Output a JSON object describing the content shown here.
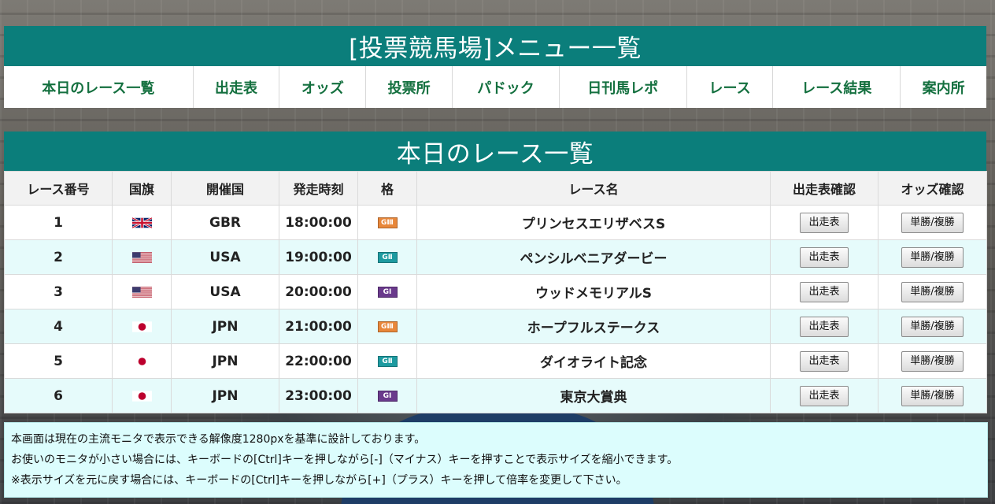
{
  "colors": {
    "header": "#0b7e7b",
    "nav_text": "#14703f",
    "row_alt": "#e6fbfb",
    "notice_bg": "#dcfdfd"
  },
  "menu": {
    "title": "[投票競馬場]メニュー一覧",
    "items": [
      {
        "label": "本日のレース一覧"
      },
      {
        "label": "出走表"
      },
      {
        "label": "オッズ"
      },
      {
        "label": "投票所"
      },
      {
        "label": "パドック"
      },
      {
        "label": "日刊馬レポ"
      },
      {
        "label": "レース"
      },
      {
        "label": "レース結果"
      },
      {
        "label": "案内所"
      }
    ]
  },
  "races": {
    "title": "本日のレース一覧",
    "columns": [
      "レース番号",
      "国旗",
      "開催国",
      "発走時刻",
      "格",
      "レース名",
      "出走表確認",
      "オッズ確認"
    ],
    "rows": [
      {
        "no": "1",
        "flag": "uk-flag-icon",
        "country": "GBR",
        "time": "18:00:00",
        "grade": "GⅢ",
        "grade_color": "#e8873a",
        "name": "プリンセスエリザベスS",
        "entry_btn": "出走表",
        "odds_btn": "単勝/複勝"
      },
      {
        "no": "2",
        "flag": "usa-flag-icon",
        "country": "USA",
        "time": "19:00:00",
        "grade": "GⅡ",
        "grade_color": "#1d9aa0",
        "name": "ペンシルベニアダービー",
        "entry_btn": "出走表",
        "odds_btn": "単勝/複勝"
      },
      {
        "no": "3",
        "flag": "usa-flag-icon",
        "country": "USA",
        "time": "20:00:00",
        "grade": "GⅠ",
        "grade_color": "#6a3a8c",
        "name": "ウッドメモリアルS",
        "entry_btn": "出走表",
        "odds_btn": "単勝/複勝"
      },
      {
        "no": "4",
        "flag": "japan-flag-icon",
        "country": "JPN",
        "time": "21:00:00",
        "grade": "GⅢ",
        "grade_color": "#e8873a",
        "name": "ホープフルステークス",
        "entry_btn": "出走表",
        "odds_btn": "単勝/複勝"
      },
      {
        "no": "5",
        "flag": "japan-flag-icon",
        "country": "JPN",
        "time": "22:00:00",
        "grade": "GⅡ",
        "grade_color": "#1d9aa0",
        "name": "ダイオライト記念",
        "entry_btn": "出走表",
        "odds_btn": "単勝/複勝"
      },
      {
        "no": "6",
        "flag": "japan-flag-icon",
        "country": "JPN",
        "time": "23:00:00",
        "grade": "GⅠ",
        "grade_color": "#6a3a8c",
        "name": "東京大賞典",
        "entry_btn": "出走表",
        "odds_btn": "単勝/複勝"
      }
    ]
  },
  "notice": {
    "lines": [
      "本画面は現在の主流モニタで表示できる解像度1280pxを基準に設計しております。",
      "お使いのモニタが小さい場合には、キーボードの[Ctrl]キーを押しながら[-]（マイナス）キーを押すことで表示サイズを縮小できます。",
      "※表示サイズを元に戻す場合には、キーボードの[Ctrl]キーを押しながら[+]（プラス）キーを押して倍率を変更して下さい。"
    ]
  }
}
